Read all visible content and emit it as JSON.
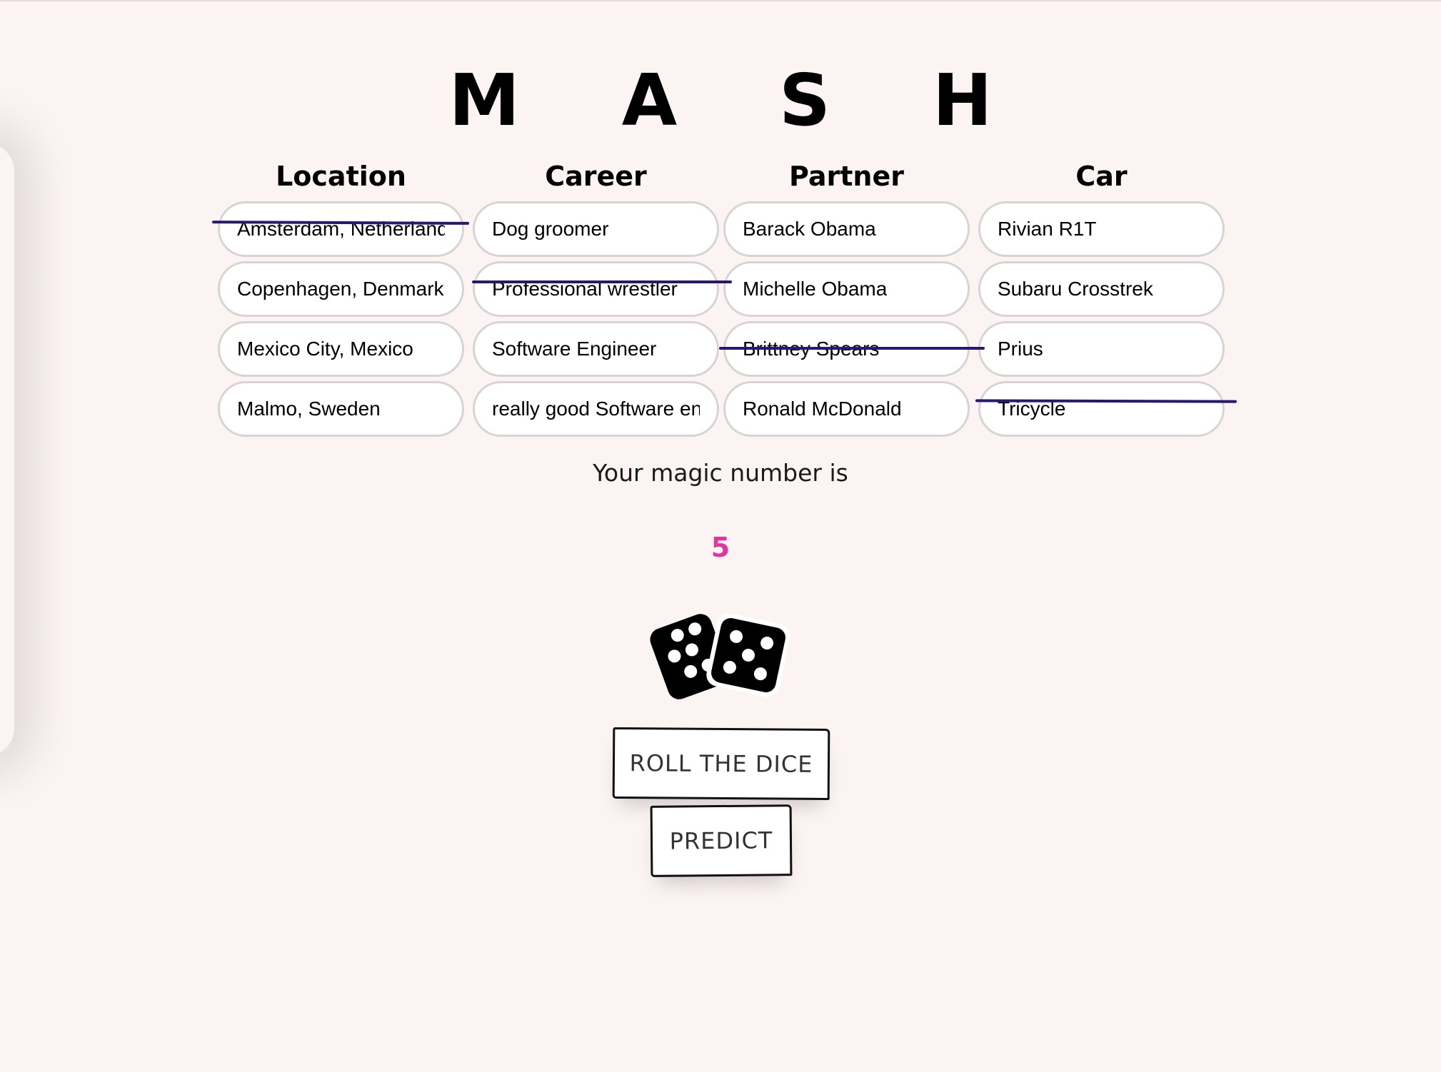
{
  "title": "M A S H",
  "columns": [
    {
      "header": "Location",
      "items": [
        {
          "text": "Amsterdam, Netherlands",
          "crossed": true
        },
        {
          "text": "Copenhagen, Denmark",
          "crossed": false
        },
        {
          "text": "Mexico City, Mexico",
          "crossed": false
        },
        {
          "text": "Malmo, Sweden",
          "crossed": false
        }
      ]
    },
    {
      "header": "Career",
      "items": [
        {
          "text": "Dog groomer",
          "crossed": false
        },
        {
          "text": "Professional wrestler",
          "crossed": true
        },
        {
          "text": "Software Engineer",
          "crossed": false
        },
        {
          "text": "really good Software engineer",
          "crossed": false
        }
      ]
    },
    {
      "header": "Partner",
      "items": [
        {
          "text": "Barack Obama",
          "crossed": false
        },
        {
          "text": "Michelle Obama",
          "crossed": false
        },
        {
          "text": "Brittney Spears",
          "crossed": true
        },
        {
          "text": "Ronald McDonald",
          "crossed": false
        }
      ]
    },
    {
      "header": "Car",
      "items": [
        {
          "text": "Rivian R1T",
          "crossed": false
        },
        {
          "text": "Subaru Crosstrek",
          "crossed": false
        },
        {
          "text": "Prius",
          "crossed": false
        },
        {
          "text": "Tricycle",
          "crossed": true
        }
      ]
    }
  ],
  "magic_label": "Your magic number is",
  "magic_number": "5",
  "buttons": {
    "roll": "ROLL THE DICE",
    "predict": "PREDICT"
  },
  "colors": {
    "strike": "#2a1870",
    "magic_number": "#e0369b",
    "background": "#fcf3f3"
  },
  "icons": {
    "dice": "dice-icon"
  }
}
